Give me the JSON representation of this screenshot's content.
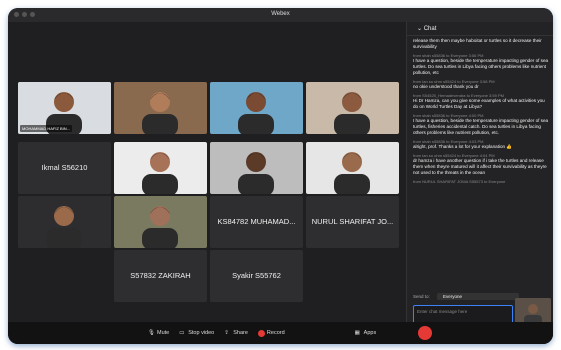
{
  "window": {
    "title": "Webex"
  },
  "participants": [
    {
      "name": "MOHAMMAD HAFIZ BIN...",
      "type": "video",
      "skin": "#8b5a3c",
      "bg": "#d9dde2",
      "active": true
    },
    {
      "name": "",
      "type": "video",
      "skin": "#b07c5a",
      "bg": "#8a6a4f"
    },
    {
      "name": "",
      "type": "video",
      "skin": "#7a4a32",
      "bg": "#6fa7c9"
    },
    {
      "name": "",
      "type": "video",
      "skin": "#8c5b3f",
      "bg": "#c8b9a8"
    },
    {
      "name": "Ikmal S56210",
      "type": "name"
    },
    {
      "name": "",
      "type": "video",
      "skin": "#a77257",
      "bg": "#ececec"
    },
    {
      "name": "",
      "type": "video",
      "skin": "#5b3a28",
      "bg": "#bdbdbd"
    },
    {
      "name": "",
      "type": "video",
      "skin": "#9a6a4c",
      "bg": "#e6e6e6"
    },
    {
      "name": "",
      "type": "video",
      "skin": "#9a6a4a",
      "bg": "#2d2d2f"
    },
    {
      "name": "",
      "type": "video",
      "skin": "#a0715a",
      "bg": "#7a7a60"
    },
    {
      "name": "KS84782 MUHAMAD...",
      "type": "name"
    },
    {
      "name": "NURUL SHARIFAT JO...",
      "type": "name"
    },
    {
      "name": "S57832 ZAKIRAH",
      "type": "name"
    },
    {
      "name": "Syakir S55762",
      "type": "name"
    }
  ],
  "chat": {
    "title": "Chat",
    "messages": [
      {
        "from": "",
        "body": "release them then maybe haboitat or turtles so it decrease their survivability"
      },
      {
        "from": "from shah s55836 to Everyone   3:56 PM",
        "body": "I have a question, beside the temperature impacting gender of sea turtles. Do sea turtles in Libya facing others problems like nutrient pollution, etc"
      },
      {
        "from": "from Ian su uhm s55424 to Everyone   3:58 PM",
        "body": "no okie understood thank you dr"
      },
      {
        "from": "from S54525_Hemadevendra to Everyone   3:59 PM",
        "body": "Hi Dr Hamza, can you give some examples of what activities you do on World Turtles Day at Libya?"
      },
      {
        "from": "from shah s55836 to Everyone   4:00 PM",
        "body": "I have a question, beside the temperature impacting gender of sea turtles, fisheries accidental catch. Do sea turtles in Libya facing others problems like nutrient pollution, etc."
      },
      {
        "from": "from shah s55836 to Everyone   4:03 PM",
        "body": "alright, prof. Thanks a lot for your explanation 👍"
      },
      {
        "from": "from Ian su uhm s55424 to Everyone   4:04 PM",
        "body": "dr hamza i have another question if i take the turtles and release them when theyre matured will it affect their survivability as theyre not used to the threats in the ocean"
      },
      {
        "from": "from NURUL SHARIFAT JOMA S55573 to Everyone",
        "body": ""
      }
    ],
    "send_to_label": "Send to:",
    "send_to_value": "Everyone",
    "input_placeholder": "Enter chat message here"
  },
  "toolbar": {
    "mute": "Mute",
    "stop_video": "Stop video",
    "share": "Share",
    "record": "Record",
    "apps": "Apps"
  }
}
